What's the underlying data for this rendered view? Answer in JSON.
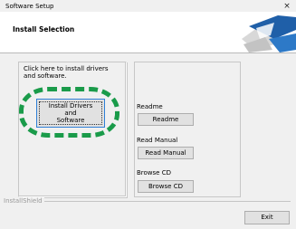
{
  "window": {
    "title": "Software Setup",
    "close_glyph": "×"
  },
  "header": {
    "title": "Install Selection",
    "logo_icon": "setup-logo-icon"
  },
  "left_panel": {
    "instruction": "Click here to install drivers and software.",
    "install_button_lines": [
      "Install Drivers",
      "and",
      "Software"
    ]
  },
  "right_panel": {
    "readme": {
      "label": "Readme",
      "button": "Readme"
    },
    "manual": {
      "label": "Read Manual",
      "button": "Read Manual"
    },
    "browse": {
      "label": "Browse CD",
      "button": "Browse CD"
    }
  },
  "footer": {
    "group_label": "InstallShield",
    "exit_button": "Exit"
  },
  "colors": {
    "highlight": "#1a9b4a",
    "logo_blue": "#1f5fa8",
    "focus_border": "#2f7fd6"
  }
}
